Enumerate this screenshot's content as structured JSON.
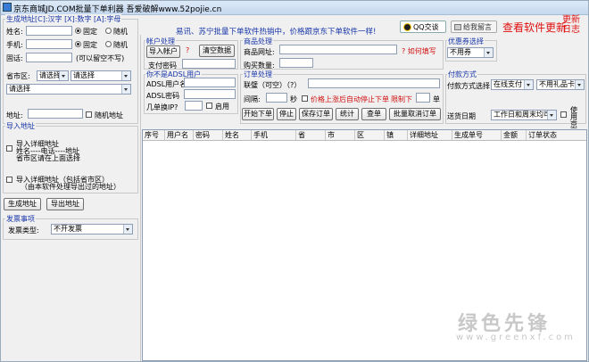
{
  "window": {
    "title": "京东商城JD.COM批量下单利器 吾爱破解www.52pojie.cn"
  },
  "top_buttons": {
    "qq_label": "QQ交谈",
    "message_label": "给我留言",
    "update_label": "查看软件更新",
    "update_log_label": "更新日志"
  },
  "notice": "易讯、苏宁批量下单软件热销中，价格跟京东下单软件一样!",
  "address_gen": {
    "title": "生成地址[C]:汉字 [X]:数字 [A]:字母",
    "name_label": "姓名:",
    "name_value": "",
    "phone_label": "手机:",
    "phone_value": "",
    "landline_label": "固话:",
    "landline_value": "",
    "landline_hint": "(可以留空不写)",
    "fixed_label": "固定",
    "random_label": "随机",
    "province_label": "省市区:",
    "province_select": "请选择",
    "city_select": "请选择",
    "district_select": "请选择",
    "address_label": "地址:",
    "address_value": "",
    "random_address_label": "随机地址"
  },
  "import_address": {
    "title": "导入地址",
    "option1_line1": "导入详细地址",
    "option1_line2": "姓名----电话----地址",
    "option1_line3": "省市区请在上面选择",
    "option2_line1": "导入详细地址（包括省市区）",
    "option2_line2": "（由本软件处理导出过的地址）",
    "generate_button": "生成地址",
    "export_button": "导出地址"
  },
  "invoice": {
    "title": "发票事项",
    "type_label": "发票类型:",
    "type_value": "不开发票"
  },
  "account": {
    "title": "帐户处理",
    "import_button": "导入帐户",
    "question_mark": "?",
    "clear_button": "清空数据",
    "pay_password_label": "支付密码",
    "pay_password_value": ""
  },
  "adsl": {
    "title": "你不是ADSL用户",
    "user_label": "ADSL用户名",
    "user_value": "",
    "password_label": "ADSL密码",
    "password_value": "",
    "switch_ip_label": "几单换IP?",
    "switch_ip_value": "",
    "enable_label": "启用"
  },
  "product": {
    "title": "商品处理",
    "url_label": "商品网址:",
    "url_value": "",
    "how_to_fill": "? 如何填写",
    "qty_label": "购买数量:",
    "qty_value": ""
  },
  "coupon": {
    "title": "优惠券选择",
    "value": "不用券"
  },
  "order": {
    "title": "订单处理",
    "contact_label": "联璧（可空）（?）",
    "contact_value": "",
    "interval_label": "间隔:",
    "interval_value": "",
    "seconds_label": "秒",
    "price_stop_label": "价格上涨后自动停止下单",
    "limit_label": "限制下",
    "limit_value": "",
    "limit_unit": "单",
    "buttons": [
      "开始下单",
      "停止",
      "保存订单",
      "统计",
      "查单",
      "批量取消订单"
    ]
  },
  "payment": {
    "title": "付款方式",
    "method_label": "付款方式选择",
    "method_value": "在线支付",
    "gift_value": "不用礼品卡",
    "delivery_label": "送货日期",
    "delivery_value": "工作日和周末均可",
    "jingdou_label": "使用京豆"
  },
  "table": {
    "columns": [
      "序号",
      "用户名",
      "密码",
      "姓名",
      "手机",
      "省",
      "市",
      "区",
      "镇",
      "详细地址",
      "生成单号",
      "金额",
      "订单状态"
    ],
    "rows": []
  },
  "watermark": {
    "text": "绿色先锋",
    "url": "www.greenxf.com"
  }
}
